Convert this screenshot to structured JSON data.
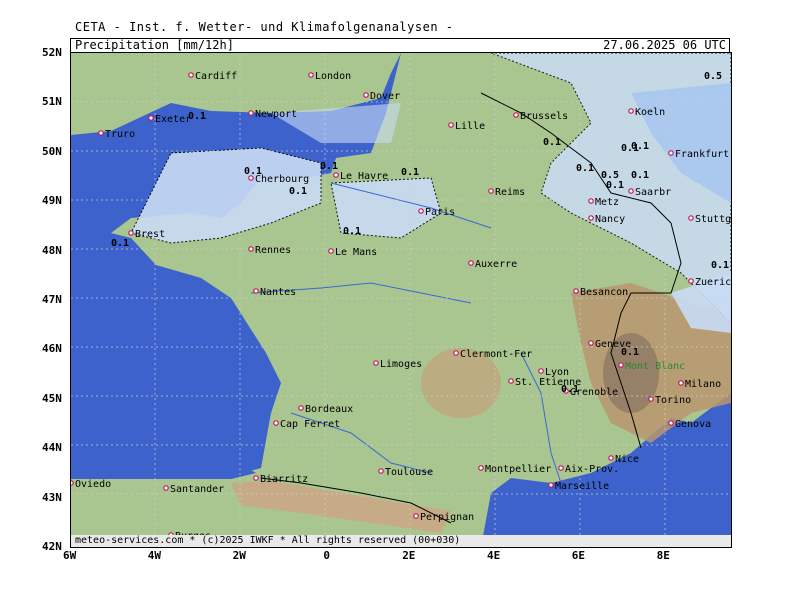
{
  "header": {
    "source": "CETA - Inst. f. Wetter- und Klimafolgenanalysen -",
    "product": "Precipitation [mm/12h]",
    "valid_time": "27.06.2025 06 UTC"
  },
  "axes": {
    "lat_labels": [
      "52N",
      "51N",
      "50N",
      "49N",
      "48N",
      "47N",
      "46N",
      "45N",
      "44N",
      "43N",
      "42N"
    ],
    "lon_labels": [
      "6W",
      "4W",
      "2W",
      "0",
      "2E",
      "4E",
      "6E",
      "8E"
    ]
  },
  "cities": [
    "Cardiff",
    "London",
    "Exeter",
    "Newport",
    "Dover",
    "Truro",
    "Lille",
    "Brussels",
    "Koeln",
    "Frankfurt",
    "Reims",
    "Le Havre",
    "Cherbourg",
    "Brest",
    "Paris",
    "Metz",
    "Saarbr",
    "Nancy",
    "Stuttgart",
    "Rennes",
    "Le Mans",
    "Auxerre",
    "Zuerich",
    "Nantes",
    "Besancon",
    "Geneve",
    "Clermont-Fer",
    "Lyon",
    "Limoges",
    "Mont Blanc",
    "St. Etienne",
    "Grenoble",
    "Milano",
    "Bordeaux",
    "Torino",
    "Cap Ferret",
    "Genova",
    "Montpellier",
    "Nice",
    "Aix-Prov.",
    "Biarritz",
    "Toulouse",
    "Marseille",
    "Oviedo",
    "Santander",
    "Perpignan",
    "Burgos"
  ],
  "contour_labels": [
    "0.5",
    "0.1",
    "0.1",
    "0.1",
    "0.1",
    "0.1",
    "0.1",
    "0.1",
    "0.1",
    "0.1",
    "0.1",
    "0.1",
    "0.5",
    "0.1",
    "0.1",
    "0.1",
    "0.1",
    "0.1"
  ],
  "footer": "meteo-services.com * (c)2025 IWKF * All rights reserved (00+030)",
  "colors": {
    "sea": "#3d62cc",
    "land": "#a9c590",
    "precip_light": "#c9dcf5",
    "precip_med": "#a9c6ee",
    "mountain": "#c9a785"
  }
}
